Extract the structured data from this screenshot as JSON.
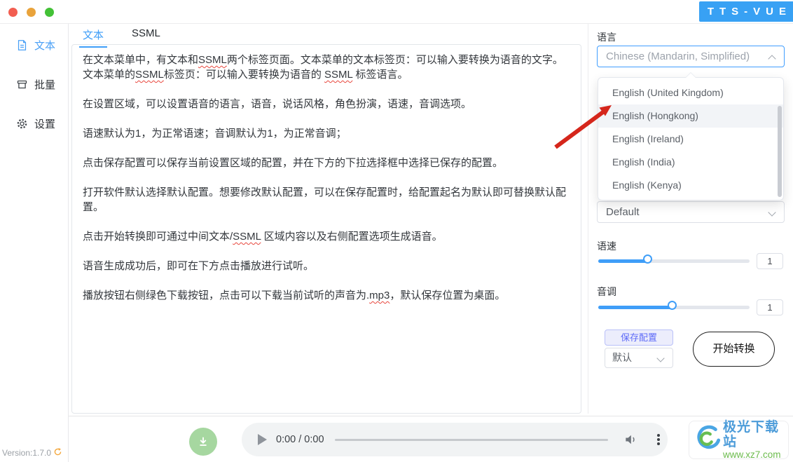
{
  "window": {
    "traffic_lights": [
      "close",
      "minimize",
      "maximize"
    ],
    "logo_text": "TTS-VUE",
    "version_text": "Version:1.7.0"
  },
  "sidebar": {
    "items": [
      {
        "label": "文本",
        "icon": "document-icon",
        "active": true
      },
      {
        "label": "批量",
        "icon": "batch-icon",
        "active": false
      },
      {
        "label": "设置",
        "icon": "gear-icon",
        "active": false
      }
    ]
  },
  "tabs": [
    {
      "label": "文本",
      "active": true
    },
    {
      "label": "SSML",
      "active": false
    }
  ],
  "editor": {
    "paragraphs": [
      [
        "在文本菜单中，有文本和",
        {
          "w": "SSML"
        },
        "两个标签页面。文本菜单的文本标签页：可以输入要转换为语音的文字。 文本菜单的",
        {
          "w": "SSML"
        },
        "标签页：可以输入要转换为语音的 ",
        {
          "w": "SSML"
        },
        " 标签语言。"
      ],
      [
        "在设置区域，可以设置语音的语言，语音，说话风格，角色扮演，语速，音调选项。"
      ],
      [
        "语速默认为1，为正常语速；音调默认为1，为正常音调；"
      ],
      [
        "点击保存配置可以保存当前设置区域的配置，并在下方的下拉选择框中选择已保存的配置。"
      ],
      [
        "打开软件默认选择默认配置。想要修改默认配置，可以在保存配置时，给配置起名为默认即可替换默认配置。"
      ],
      [
        "点击开始转换即可通过中间文本/",
        {
          "w": "SSML"
        },
        " 区域内容以及右侧配置选项生成语音。"
      ],
      [
        "语音生成成功后，即可在下方点击播放进行试听。"
      ],
      [
        "播放按钮右侧绿色下载按钮，点击可以下载当前试听的声音为.",
        {
          "w": "mp3"
        },
        "，默认保存位置为桌面。"
      ]
    ]
  },
  "settings": {
    "language_label": "语言",
    "language_value": "Chinese (Mandarin, Simplified)",
    "language_dropdown": {
      "options": [
        {
          "label": "English (United Kingdom)",
          "highlighted": false
        },
        {
          "label": "English (Hongkong)",
          "highlighted": true
        },
        {
          "label": "English (Ireland)",
          "highlighted": false
        },
        {
          "label": "English (India)",
          "highlighted": false
        },
        {
          "label": "English (Kenya)",
          "highlighted": false
        }
      ]
    },
    "voice_value": "Default",
    "rate_label": "语速",
    "rate_value": "1",
    "rate_percent": 34,
    "pitch_label": "音调",
    "pitch_value": "1",
    "pitch_percent": 50,
    "save_config_label": "保存配置",
    "preset_value": "默认",
    "convert_label": "开始转换"
  },
  "player": {
    "time_display": "0:00 / 0:00"
  },
  "watermark": {
    "site_name": "极光下载站",
    "site_url": "www.xz7.com"
  },
  "colors": {
    "accent_blue": "#409eff",
    "logo_blue": "#38a1f4",
    "save_button_purple": "#5d6af8",
    "download_green": "#a6d7a0",
    "arrow_red": "#d5261b",
    "watermark_blue": "#4d9cd9",
    "watermark_green": "#6cbb4d"
  }
}
